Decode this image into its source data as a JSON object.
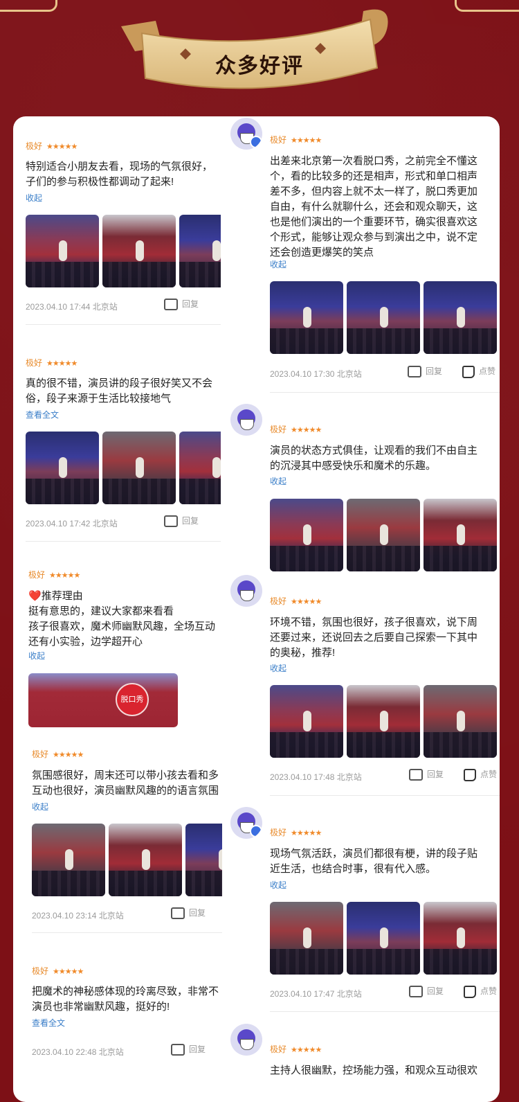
{
  "banner": {
    "title": "众多好评"
  },
  "rating_label": "极好",
  "stars": "★★★★★",
  "actions": {
    "reply": "回复",
    "like": "点赞"
  },
  "left": [
    {
      "text": "特别适合小朋友去看，现场的气氛很好，\n子们的参与积极性都调动了起来!",
      "toggle": "收起",
      "time": "2023.04.10 17:44",
      "station": "北京站"
    },
    {
      "text": "真的很不错，演员讲的段子很好笑又不会\n俗，段子来源于生活比较接地气",
      "toggle": "查看全文",
      "time": "2023.04.10 17:42",
      "station": "北京站"
    },
    {
      "heart": "❤️",
      "reason": "推荐理由",
      "text": "挺有意思的，建议大家都来看看\n孩子很喜欢，魔术师幽默风趣，全场互动\n还有小实验，边学超开心",
      "toggle": "收起"
    },
    {
      "text": "氛围感很好，周末还可以带小孩去看和多\n互动也很好，演员幽默风趣的的语言氛围",
      "toggle": "收起",
      "time": "2023.04.10 23:14",
      "station": "北京站"
    },
    {
      "text": "把魔术的神秘感体现的玲离尽致，非常不\n演员也非常幽默风趣，挺好的!",
      "toggle": "查看全文",
      "time": "2023.04.10 22:48",
      "station": "北京站"
    }
  ],
  "right": [
    {
      "text": "出差来北京第一次看脱口秀，之前完全不懂这\n个，看的比较多的还是相声，形式和单口相声\n差不多，但内容上就不太一样了，脱口秀更加\n自由，有什么就聊什么，还会和观众聊天，这\n也是他们演出的一个重要环节，确实很喜欢这\n个形式，能够让观众参与到演出之中，说不定\n还会创造更爆笑的笑点",
      "toggle": "收起",
      "time": "2023.04.10 17:30",
      "station": "北京站"
    },
    {
      "text": "演员的状态方式俱佳，让观看的我们不由自主\n的沉浸其中感受快乐和魔术的乐趣。",
      "toggle": "收起"
    },
    {
      "text": "环境不错，氛围也很好，孩子很喜欢，说下周\n还要过来，还说回去之后要自己探索一下其中\n的奥秘，推荐!",
      "toggle": "收起",
      "time": "2023.04.10 17:48",
      "station": "北京站"
    },
    {
      "text": "现场气氛活跃，演员们都很有梗，讲的段子贴\n近生活，也结合时事，很有代入感。",
      "toggle": "收起",
      "time": "2023.04.10 17:47",
      "station": "北京站"
    },
    {
      "text": "主持人很幽默，控场能力强，和观众互动很欢"
    }
  ],
  "photo_logo": "脱口秀"
}
